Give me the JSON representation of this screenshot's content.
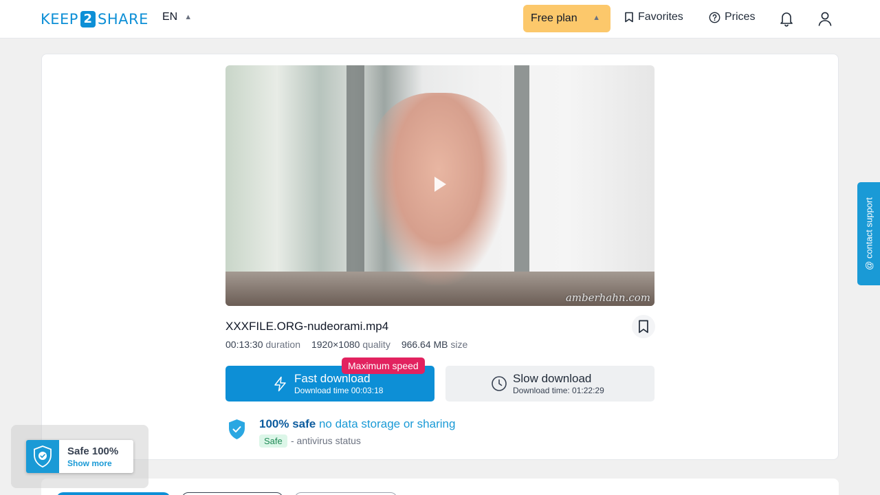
{
  "header": {
    "logo": {
      "left": "KEEP",
      "middle": "2",
      "right": "SHARE"
    },
    "language": "EN",
    "plan_label": "Free plan",
    "favorites_label": "Favorites",
    "prices_label": "Prices"
  },
  "video": {
    "watermark": "amberhahn.com"
  },
  "file": {
    "name": "XXXFILE.ORG-nudeorami.mp4",
    "duration_value": "00:13:30",
    "duration_label": "duration",
    "quality_value": "1920×1080",
    "quality_label": "quality",
    "size_value": "966.64 MB",
    "size_label": "size"
  },
  "download": {
    "badge": "Maximum speed",
    "fast_title": "Fast download",
    "fast_sub": "Download time 00:03:18",
    "slow_title": "Slow download",
    "slow_sub": "Download time: 01:22:29"
  },
  "safety": {
    "bold": "100% safe",
    "normal": "no data storage or sharing",
    "pill": "Safe",
    "status": "- antivirus status"
  },
  "contact_label": "@ contact support",
  "safe_widget": {
    "title": "Safe 100%",
    "link": "Show more"
  },
  "colors": {
    "brand": "#0d8fd6",
    "plan": "#fcc86b",
    "badge": "#e2225f",
    "safe": "#1e8a55"
  }
}
